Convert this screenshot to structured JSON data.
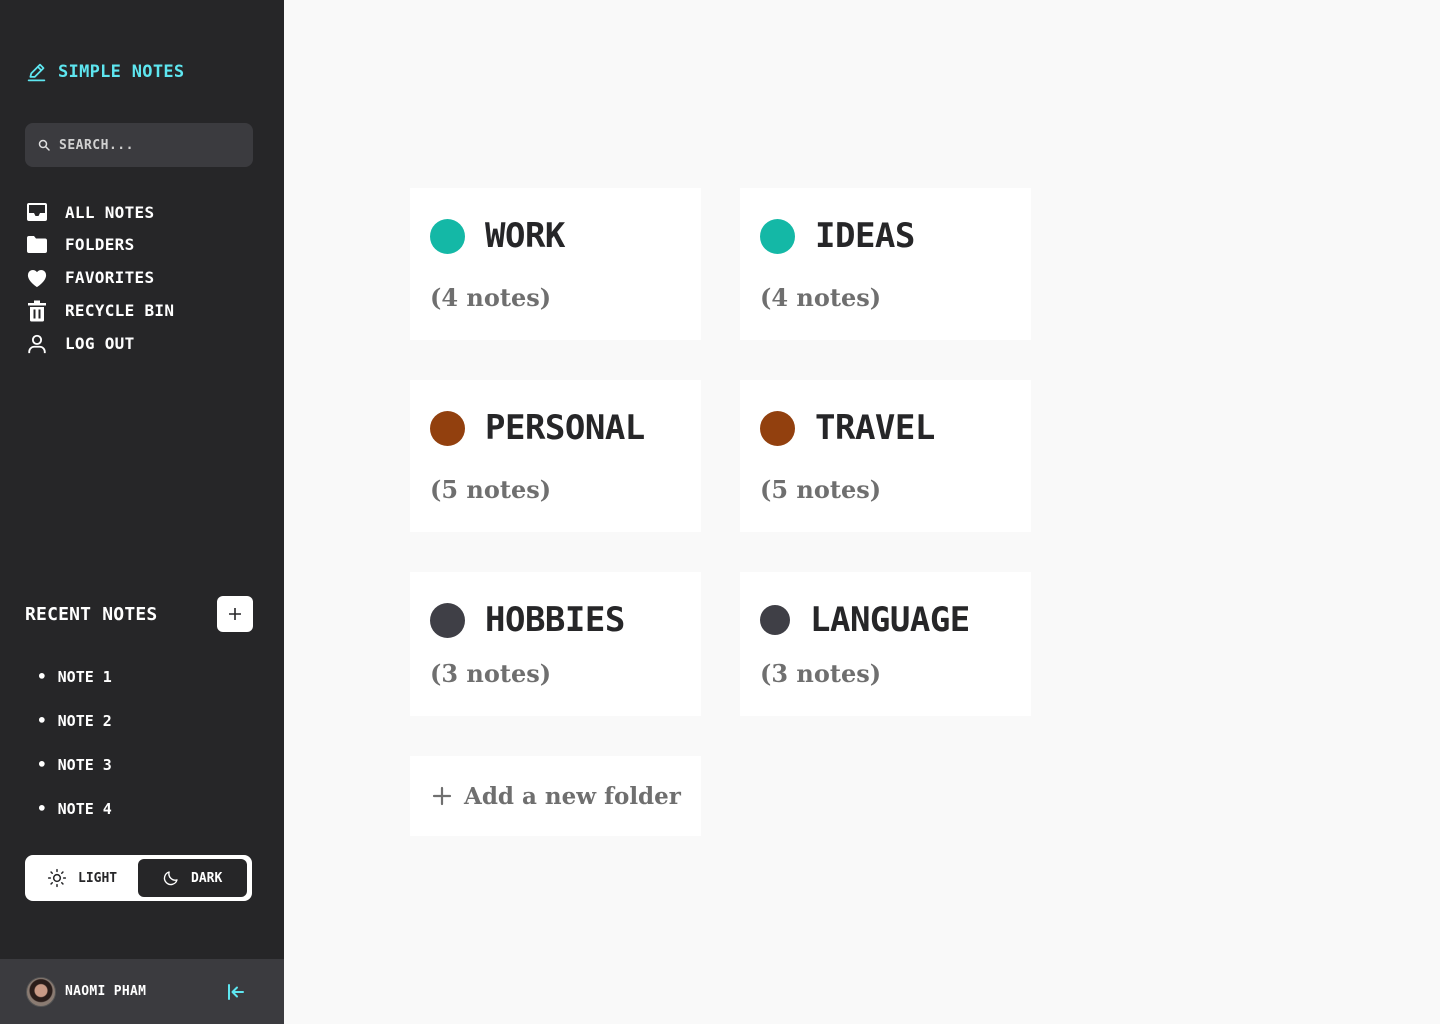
{
  "app": {
    "title": "SIMPLE NOTES",
    "accent": "#5ee6f0"
  },
  "search": {
    "placeholder": "SEARCH..."
  },
  "nav": {
    "items": [
      {
        "label": "ALL NOTES",
        "icon": "inbox-icon"
      },
      {
        "label": "FOLDERS",
        "icon": "folder-icon"
      },
      {
        "label": "FAVORITES",
        "icon": "heart-icon"
      },
      {
        "label": "RECYCLE BIN",
        "icon": "trash-icon"
      },
      {
        "label": "LOG OUT",
        "icon": "user-icon"
      }
    ]
  },
  "recent": {
    "title": "RECENT NOTES",
    "add_icon": "plus-icon",
    "items": [
      "NOTE 1",
      "NOTE 2",
      "NOTE 3",
      "NOTE 4"
    ]
  },
  "theme": {
    "light_label": "LIGHT",
    "dark_label": "DARK",
    "selected": "DARK"
  },
  "user": {
    "name": "NAOMI PHAM"
  },
  "folders": [
    {
      "name": "WORK",
      "count": "(4 notes)",
      "color": "#14b8a6"
    },
    {
      "name": "IDEAS",
      "count": "(4 notes)",
      "color": "#14b8a6"
    },
    {
      "name": "PERSONAL",
      "count": "(5 notes)",
      "color": "#92400e"
    },
    {
      "name": "TRAVEL",
      "count": "(5 notes)",
      "color": "#92400e"
    },
    {
      "name": "HOBBIES",
      "count": "(3 notes)",
      "color": "#3f3f46"
    },
    {
      "name": "LANGUAGE",
      "count": "(3 notes)",
      "color": "#3f3f46"
    }
  ],
  "add_folder": {
    "label": "Add a new folder"
  }
}
